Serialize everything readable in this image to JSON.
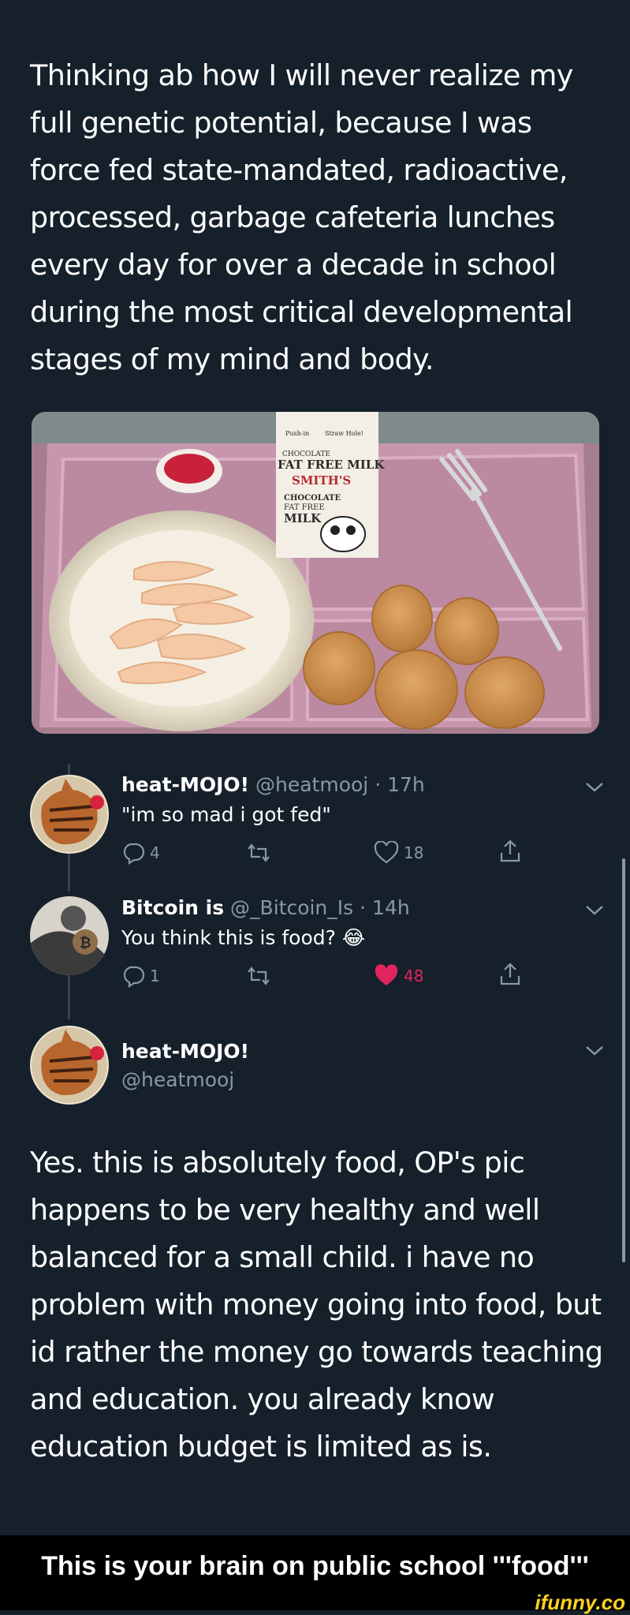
{
  "original_tweet": {
    "text": "Thinking ab how I will never realize my\nfull genetic potential, because I was\nforce fed state-mandated, radioactive,\nprocessed, garbage cafeteria lunches\nevery day for over a decade in school\nduring the most critical developmental\nstages of my mind and body."
  },
  "photo": {
    "carton": {
      "line1": "Push-in",
      "line2": "Straw Hole!",
      "line3": "CHOCOLATE",
      "line4": "FAT FREE MILK",
      "brand": "SMITH'S",
      "line5": "CHOCOLATE",
      "line6": "FAT FREE",
      "line7": "MILK"
    }
  },
  "replies": [
    {
      "name": "heat-MOJO!",
      "handle": "@heatmooj",
      "time": "· 17h",
      "text": "\"im so mad i got fed\"",
      "reply_count": "4",
      "retweet_count": "",
      "like_count": "18",
      "liked": false
    },
    {
      "name": "Bitcoin is",
      "handle": "@_Bitcoin_Is",
      "time": "· 14h",
      "text": "You think this is food?",
      "emoji": "😂",
      "reply_count": "1",
      "retweet_count": "",
      "like_count": "48",
      "liked": true
    }
  ],
  "main_reply": {
    "name": "heat-MOJO!",
    "handle": "@heatmooj",
    "text": "Yes. this is absolutely food, OP's pic\nhappens to be very healthy and well\nbalanced for a small child. i have no\nproblem with money going into food, but\nid rather the money go towards teaching\nand education. you already know\neducation budget is limited as is."
  },
  "caption": "This is your brain on public school '''food'''",
  "watermark": "ifunny.co",
  "colors": {
    "background": "#15202b",
    "secondary_text": "#8899a6",
    "like_active": "#e0245e",
    "watermark": "#ffd21f"
  }
}
